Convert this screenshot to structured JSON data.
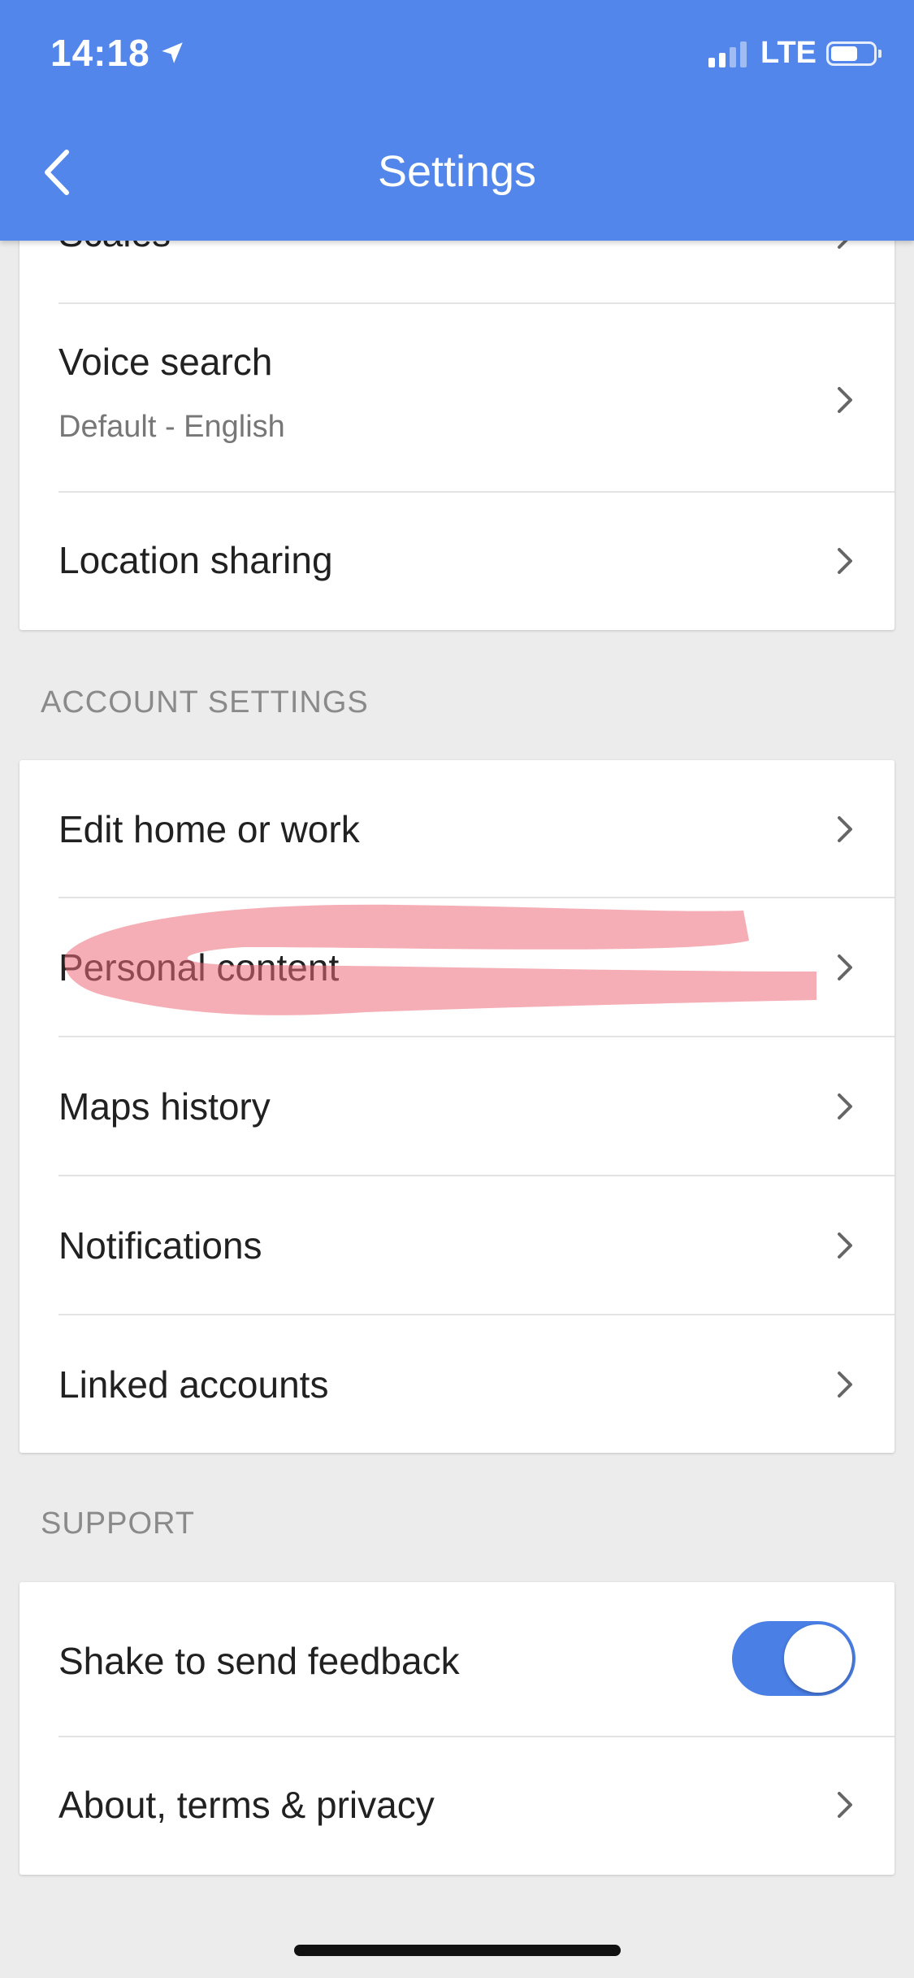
{
  "status_bar": {
    "time": "14:18",
    "network": "LTE"
  },
  "header": {
    "title": "Settings"
  },
  "top_card": {
    "clipped_label": "Scales",
    "items": [
      {
        "label": "Voice search",
        "subtitle": "Default - English"
      },
      {
        "label": "Location sharing"
      }
    ]
  },
  "account_settings": {
    "header": "ACCOUNT SETTINGS",
    "items": [
      {
        "label": "Edit home or work"
      },
      {
        "label": "Personal content"
      },
      {
        "label": "Maps history"
      },
      {
        "label": "Notifications"
      },
      {
        "label": "Linked accounts"
      }
    ]
  },
  "support": {
    "header": "SUPPORT",
    "items": [
      {
        "label": "Shake to send feedback",
        "toggle_on": true
      },
      {
        "label": "About, terms & privacy"
      }
    ]
  },
  "colors": {
    "header_bg": "#5286ea",
    "toggle_on": "#4a7fe6",
    "scribble": "#ec6b7a"
  },
  "icons": [
    "back-arrow-icon",
    "location-arrow-icon",
    "chevron-right-icon"
  ]
}
